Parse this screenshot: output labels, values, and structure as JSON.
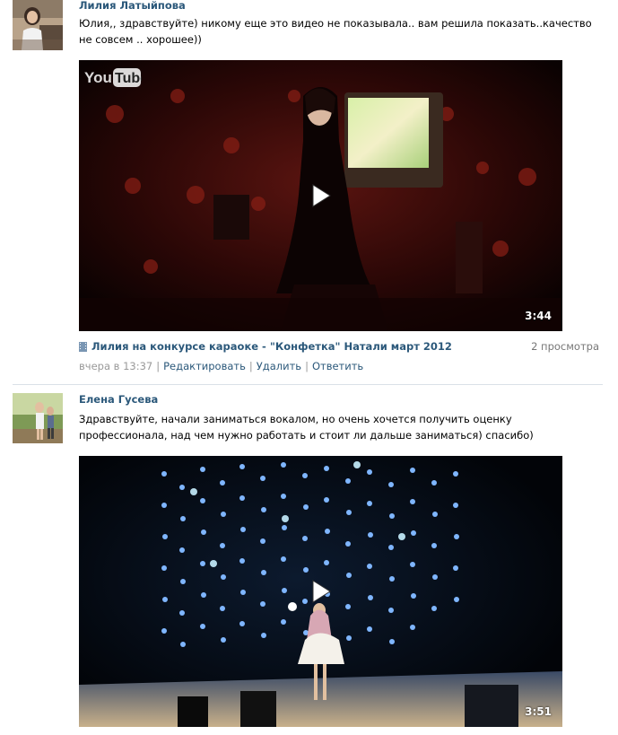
{
  "posts": [
    {
      "author": "Лилия Латыйпова",
      "text": "Юлия,, здравствуйте) никому еще это видео не показывала.. вам решила показать..качество не совсем .. хорошее))",
      "video": {
        "duration": "3:44",
        "logo": "YouTube",
        "title": "Лилия на конкурсе караоке - \"Конфетка\" Натали март 2012",
        "views": "2 просмотра"
      },
      "meta": {
        "time": "вчера в 13:37",
        "actions": [
          "Редактировать",
          "Удалить",
          "Ответить"
        ]
      }
    },
    {
      "author": "Елена Гусева",
      "text": "Здравствуйте, начали заниматься вокалом, но очень хочется получить оценку профессионала, над чем нужно работать и стоит ли дальше заниматься) спасибо)",
      "video": {
        "duration": "3:51"
      }
    }
  ],
  "colors": {
    "link": "#2b587a",
    "muted": "#999999",
    "divider": "#dae1e8"
  }
}
